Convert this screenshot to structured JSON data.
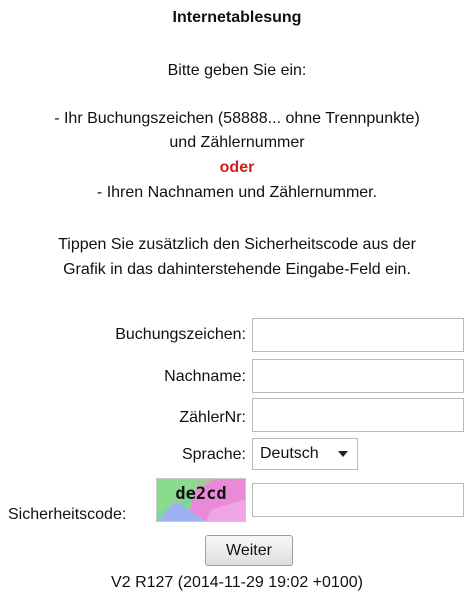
{
  "header": {
    "title": "Internetablesung",
    "intro": "Bitte geben Sie ein:",
    "option1_line1": "- Ihr Buchungszeichen (58888... ohne Trennpunkte)",
    "option1_line2": "und Zählernummer",
    "or_text": "oder",
    "option2": "- Ihren Nachnamen und Zählernummer.",
    "hint_line1": "Tippen Sie zusätzlich den Sicherheitscode aus der",
    "hint_line2": "Grafik in das dahinterstehende Eingabe-Feld ein."
  },
  "form": {
    "booking_label": "Buchungszeichen:",
    "booking_value": "",
    "lastname_label": "Nachname:",
    "lastname_value": "",
    "meter_label": "ZählerNr:",
    "meter_value": "",
    "language_label": "Sprache:",
    "language_selected": "Deutsch",
    "captcha_label": "Sicherheitscode:",
    "captcha_text": "de2cd",
    "captcha_value": "",
    "submit_label": "Weiter"
  },
  "footer": {
    "version": "V2 R127 (2014-11-29 19:02 +0100)"
  },
  "colors": {
    "accent_red": "#d11f1f",
    "captcha_green": "#7fd69a",
    "captcha_pink": "#e98ad9",
    "captcha_blue": "#9fb0f2"
  },
  "icons": {
    "dropdown": "chevron-down-icon"
  }
}
